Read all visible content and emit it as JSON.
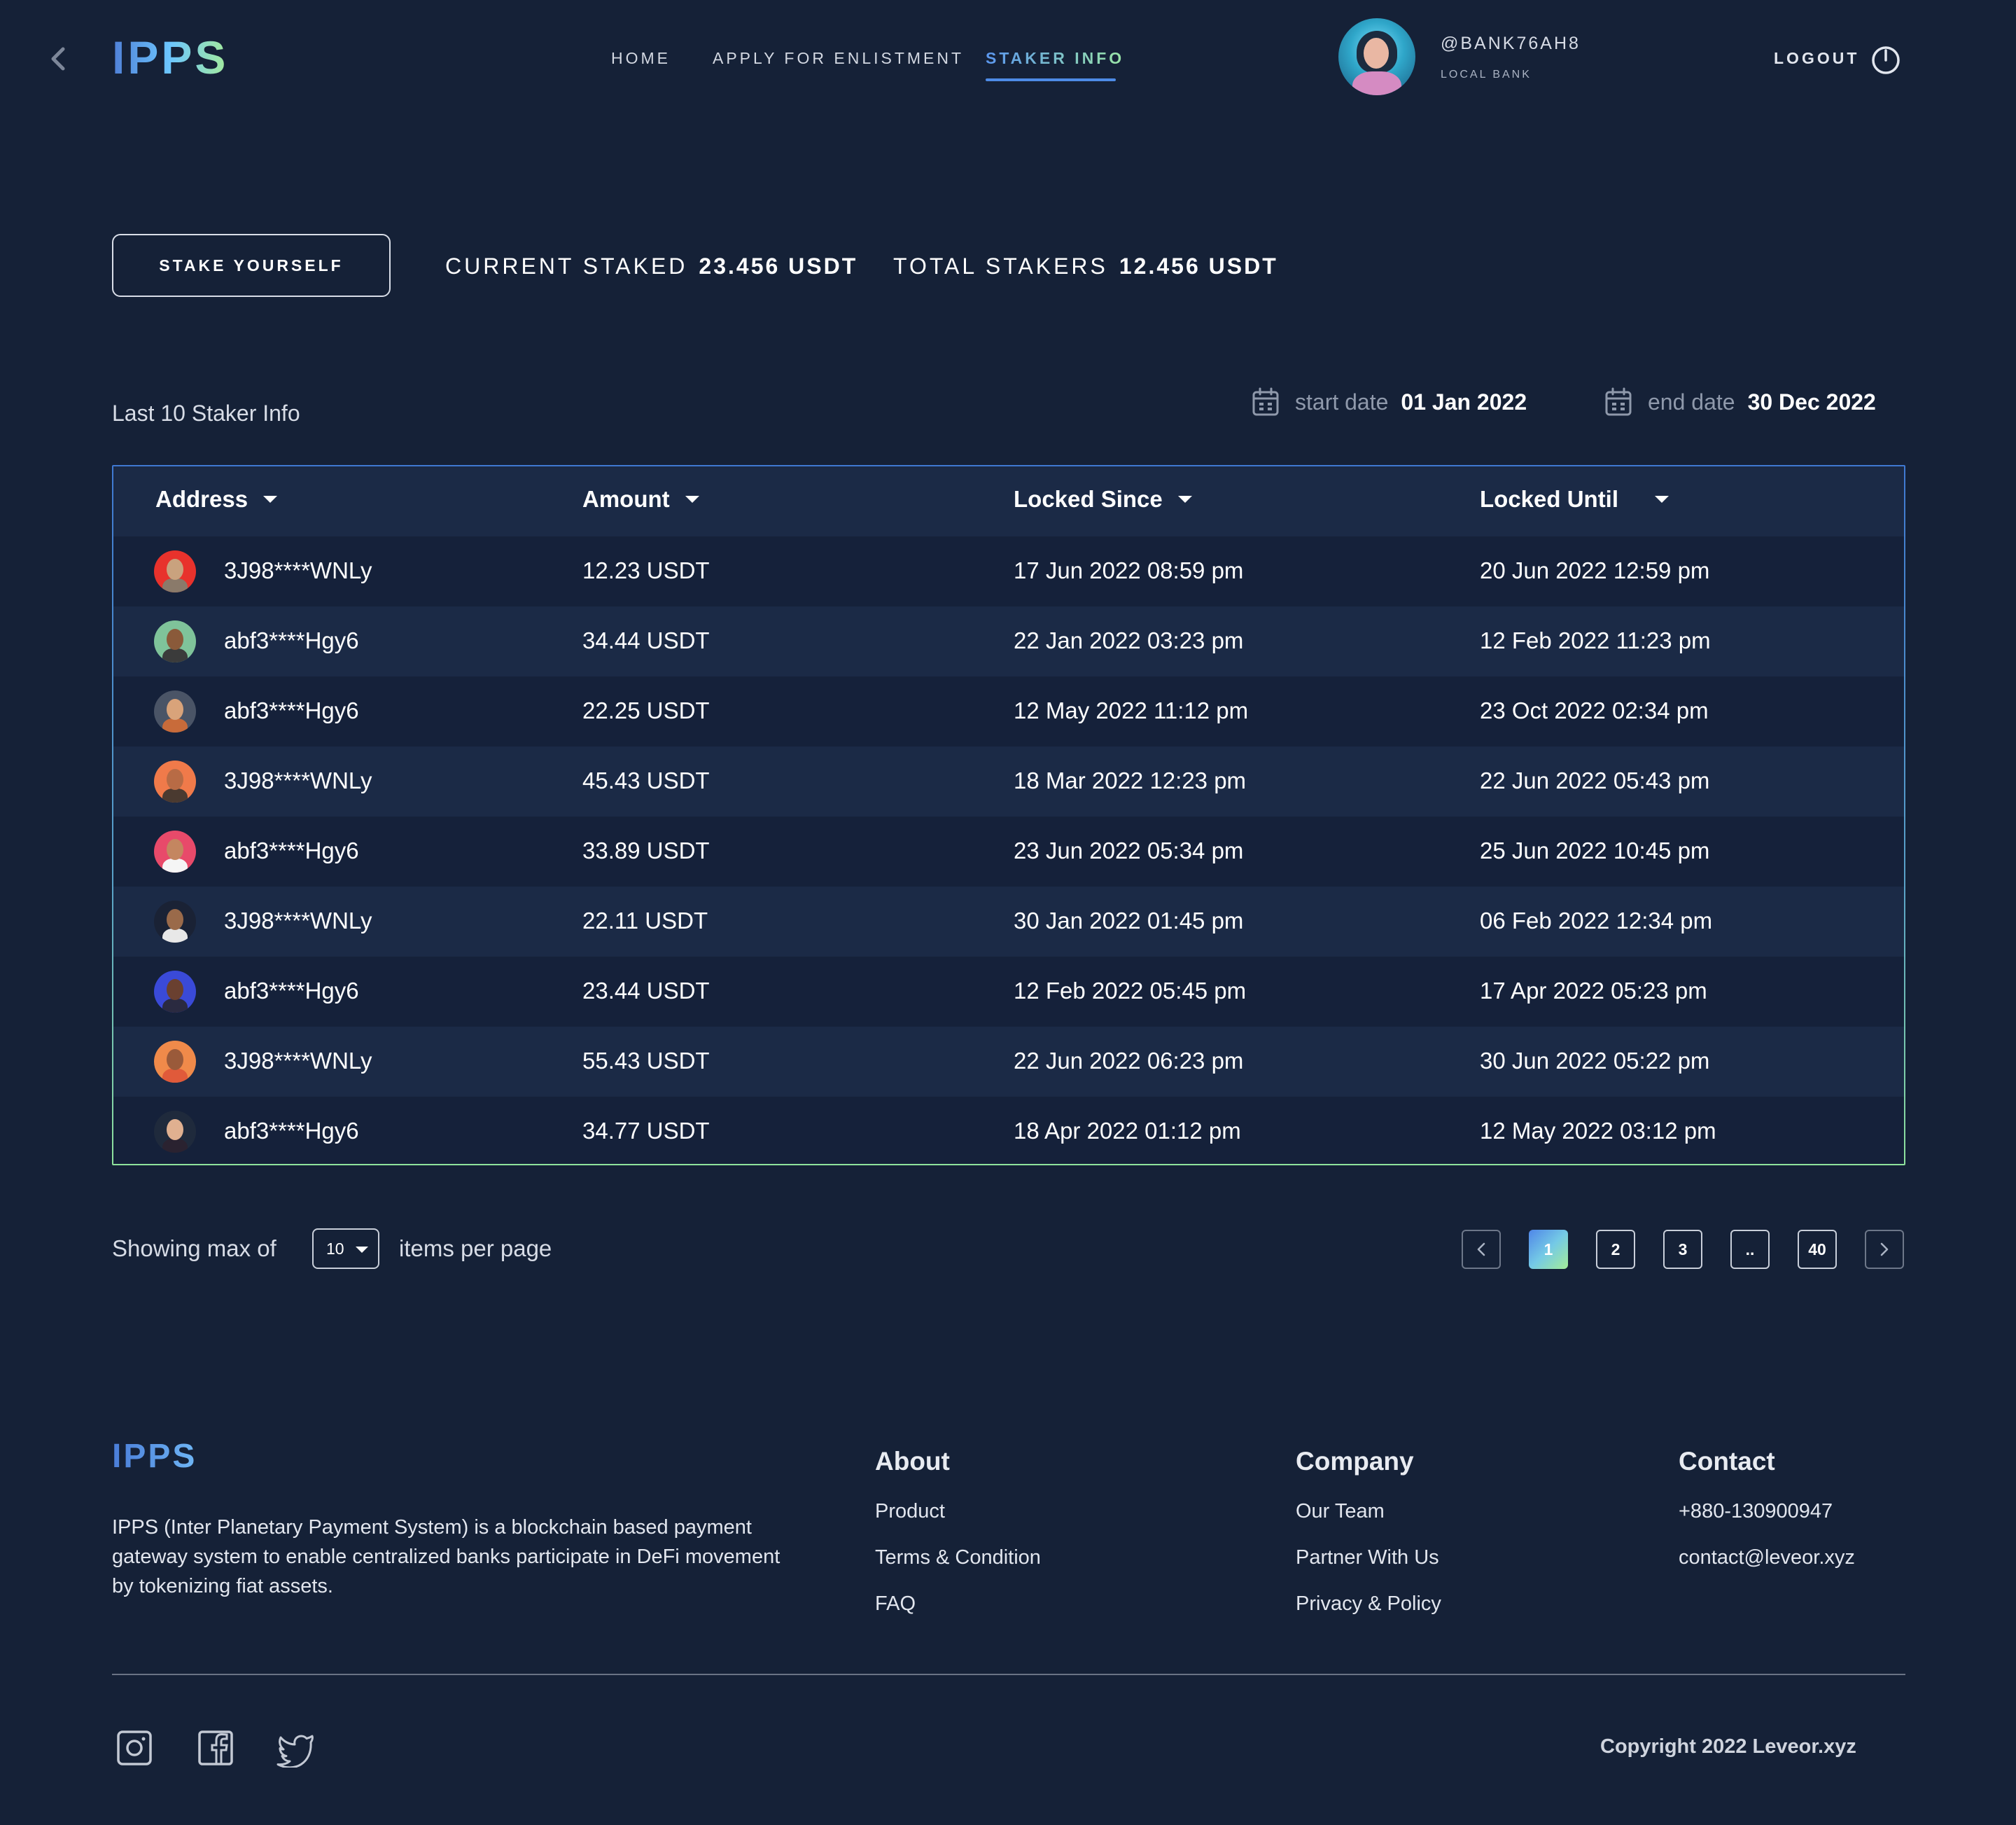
{
  "header": {
    "logo": "IPPS",
    "nav": [
      {
        "label": "HOME"
      },
      {
        "label": "APPLY FOR ENLISTMENT"
      },
      {
        "label": "STAKER INFO",
        "active": true
      }
    ],
    "user": {
      "handle": "@BANK76AH8",
      "role": "LOCAL BANK"
    },
    "logout_label": "LOGOUT"
  },
  "stats": {
    "stake_button": "STAKE YOURSELF",
    "current_staked_label": "CURRENT STAKED",
    "current_staked_value": "23.456 USDT",
    "total_stakers_label": "TOTAL STAKERS",
    "total_stakers_value": "12.456 USDT"
  },
  "filters": {
    "section_title": "Last 10 Staker Info",
    "start_label": "start date",
    "start_value": "01 Jan 2022",
    "end_label": "end date",
    "end_value": "30 Dec 2022"
  },
  "table": {
    "columns": [
      "Address",
      "Amount",
      "Locked Since",
      "Locked Until"
    ],
    "rows": [
      {
        "address": "3J98****WNLy",
        "amount": "12.23 USDT",
        "since": "17 Jun 2022 08:59 pm",
        "until": "20 Jun 2022 12:59 pm"
      },
      {
        "address": "abf3****Hgy6",
        "amount": "34.44 USDT",
        "since": "22 Jan 2022 03:23 pm",
        "until": "12 Feb 2022 11:23 pm"
      },
      {
        "address": "abf3****Hgy6",
        "amount": "22.25 USDT",
        "since": "12 May 2022 11:12 pm",
        "until": "23 Oct 2022 02:34 pm"
      },
      {
        "address": "3J98****WNLy",
        "amount": "45.43 USDT",
        "since": "18 Mar 2022 12:23 pm",
        "until": "22 Jun 2022 05:43 pm"
      },
      {
        "address": "abf3****Hgy6",
        "amount": "33.89 USDT",
        "since": "23 Jun 2022 05:34 pm",
        "until": "25 Jun 2022 10:45 pm"
      },
      {
        "address": "3J98****WNLy",
        "amount": "22.11 USDT",
        "since": "30 Jan 2022 01:45 pm",
        "until": "06 Feb 2022 12:34 pm"
      },
      {
        "address": "abf3****Hgy6",
        "amount": "23.44 USDT",
        "since": "12 Feb 2022 05:45 pm",
        "until": "17 Apr 2022 05:23 pm"
      },
      {
        "address": "3J98****WNLy",
        "amount": "55.43 USDT",
        "since": "22 Jun 2022 06:23 pm",
        "until": "30 Jun 2022 05:22 pm"
      },
      {
        "address": "abf3****Hgy6",
        "amount": "34.77 USDT",
        "since": "18 Apr 2022 01:12 pm",
        "until": "12 May 2022 03:12 pm"
      }
    ],
    "avatar_colors": [
      {
        "bg": "#e8322c",
        "face": "#c9a27e",
        "body": "#8a7a6a"
      },
      {
        "bg": "#7fc39a",
        "face": "#8a5a3a",
        "body": "#3b3b3b"
      },
      {
        "bg": "#4a5466",
        "face": "#d9a37a",
        "body": "#c86b3a"
      },
      {
        "bg": "#f07a4a",
        "face": "#b86b45",
        "body": "#4a3a30"
      },
      {
        "bg": "#e84a6a",
        "face": "#c48660",
        "body": "#f5f5f5"
      },
      {
        "bg": "#1a2235",
        "face": "#9a6a4a",
        "body": "#e8e8e8"
      },
      {
        "bg": "#3a4ad8",
        "face": "#6a4030",
        "body": "#2a2a40"
      },
      {
        "bg": "#f08a4a",
        "face": "#9a5a3a",
        "body": "#e05a3a"
      },
      {
        "bg": "#1f2a3c",
        "face": "#e0b090",
        "body": "#2a2230"
      }
    ]
  },
  "pagination": {
    "showing_label": "Showing max of",
    "per_page_value": "10",
    "items_label": "items per page",
    "pages": [
      "1",
      "2",
      "3",
      "..",
      "40"
    ],
    "active_page": "1"
  },
  "footer": {
    "logo": "IPPS",
    "description": "IPPS (Inter Planetary Payment System) is a blockchain based payment gateway system to enable centralized banks participate in DeFi movement by tokenizing fiat assets.",
    "about": {
      "title": "About",
      "links": [
        "Product",
        "Terms & Condition",
        "FAQ"
      ]
    },
    "company": {
      "title": "Company",
      "links": [
        "Our Team",
        "Partner With Us",
        "Privacy & Policy"
      ]
    },
    "contact": {
      "title": "Contact",
      "links": [
        "+880-130900947",
        "contact@leveor.xyz"
      ]
    },
    "social_icons": [
      "instagram-icon",
      "facebook-icon",
      "twitter-icon"
    ],
    "copyright": "Copyright 2022 Leveor.xyz"
  }
}
